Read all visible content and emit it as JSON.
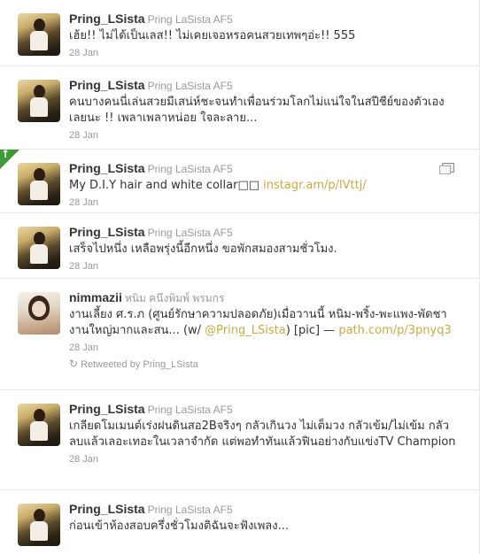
{
  "tweets": [
    {
      "name": "Pring_LSista",
      "handle": "Pring LaSista AF5",
      "text_plain": "เฮ้ย!! ไม่ได้เป็นเลส!! ไม่เคยเจอหรอคนสวยเทพๆอ่ะ!! 555",
      "date": "28 Jan"
    },
    {
      "name": "Pring_LSista",
      "handle": "Pring LaSista AF5",
      "text_plain": "คนบางคนนี่เล่นสวยมีเสน่ห์ชะจนทำเพื่อนร่วมโลกไม่แน่ใจในสปีชีย์ของตัวเองเลยนะ !! เพลาเพลาหน่อย ใจละลาย...",
      "date": "28 Jan"
    },
    {
      "name": "Pring_LSista",
      "handle": "Pring LaSista AF5",
      "text_plain": "My D.I.Y hair and white collar□□ ",
      "link": "instagr.am/p/lVttj/",
      "date": "28 Jan"
    },
    {
      "name": "Pring_LSista",
      "handle": "Pring LaSista AF5",
      "text_plain": "เสร็จไปหนึ่ง เหลือพรุ่งนี้อีกหนึ่ง ขอพักสมองสามชั่วโมง.",
      "date": "28 Jan"
    },
    {
      "name": "nimmazii",
      "handle": "หนิม คนึงพิมพ์ พรมกร",
      "text_before": "งานเลี้ยง ศ.ร.ภ (ศูนย์รักษาความปลอดภัย)เมื่อวานนี้ หนิม-พริ้ง-พะแพง-พัดชา งานใหญ่มากและสน... (w/ ",
      "mention": "@Pring_LSista",
      "text_after": ") [pic] — ",
      "link": "path.com/p/3pnyq3",
      "date": "28 Jan",
      "retweeted_by": "Retweeted by Pring_LSista"
    },
    {
      "name": "Pring_LSista",
      "handle": "Pring LaSista AF5",
      "text_plain": "เกลียดโมเมนต์เร่งฝนดินสอ2Bจริงๆ กลัวเกินวง ไม่เต็มวง กลัวเข้ม/ไม่เข้ม กลัวลบแล้วเลอะเทอะในเวลาจำกัด แต่พอทำทันแล้วฟินอย่างกับแข่งTV Champion",
      "date": "28 Jan"
    },
    {
      "name": "Pring_LSista",
      "handle": "Pring LaSista AF5",
      "text_plain": "ก่อนเข้าห้องสอบครึ่งชั่วโมงติฉันจะฟังเพลง...",
      "date": ""
    }
  ],
  "colors": {
    "link": "#c9aa3f",
    "favorite_corner": "#3d9b37",
    "meta": "#999999"
  },
  "icons": {
    "corner": "star-corner-icon",
    "media": "media-gallery-icon",
    "retweet": "retweet-icon"
  }
}
